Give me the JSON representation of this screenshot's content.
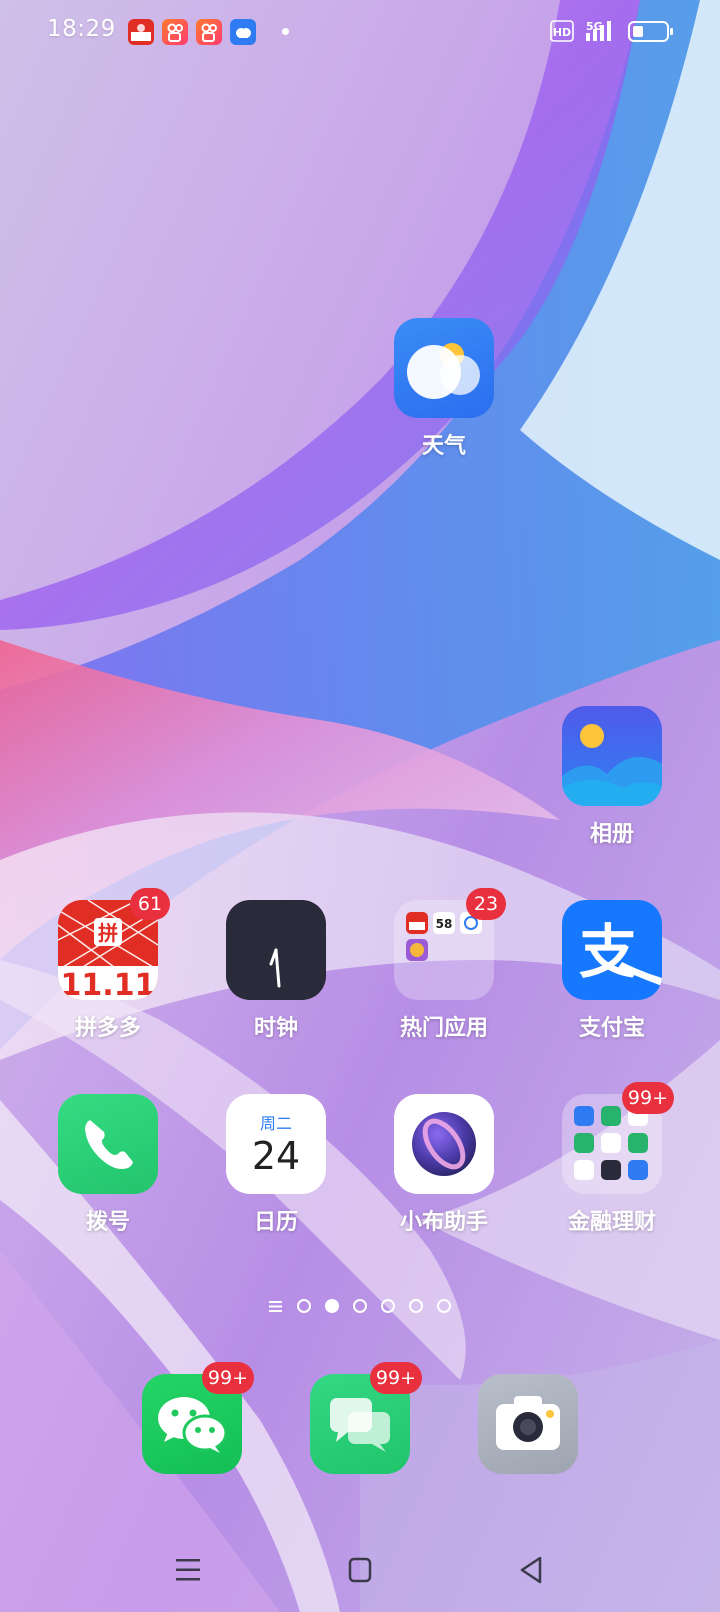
{
  "status_bar": {
    "time": "18:29",
    "notification_icons": [
      "pinduoduo-icon",
      "kuaishou-icon",
      "kuaishou-icon",
      "weather-icon"
    ],
    "hd_label": "HD",
    "network_label": "5G",
    "battery_level": 0.3
  },
  "apps": {
    "weather": {
      "label": "天气",
      "icon": "weather-icon"
    },
    "gallery": {
      "label": "相册",
      "icon": "gallery-icon"
    },
    "pinduoduo": {
      "label": "拼多多",
      "badge": "61",
      "icon_text": "11.11",
      "icon": "pinduoduo-icon"
    },
    "clock": {
      "label": "时钟",
      "icon": "clock-icon"
    },
    "hot_apps": {
      "label": "热门应用",
      "badge": "23",
      "icon": "folder-icon",
      "mini_text": "58"
    },
    "alipay": {
      "label": "支付宝",
      "icon_text": "支",
      "icon": "alipay-icon"
    },
    "phone": {
      "label": "拨号",
      "icon": "phone-icon"
    },
    "calendar": {
      "label": "日历",
      "weekday": "周二",
      "day": "24",
      "icon": "calendar-icon"
    },
    "breeno": {
      "label": "小布助手",
      "icon": "assistant-icon"
    },
    "finance": {
      "label": "金融理财",
      "badge": "99+",
      "icon": "folder-icon"
    }
  },
  "page_indicator": {
    "pages": 6,
    "active_page": 2
  },
  "dock": {
    "wechat": {
      "badge": "99+",
      "icon": "wechat-icon"
    },
    "messages": {
      "badge": "99+",
      "icon": "messages-icon"
    },
    "camera": {
      "icon": "camera-icon"
    }
  },
  "nav_bar": {
    "buttons": [
      "menu-icon",
      "home-icon",
      "back-icon"
    ]
  },
  "colors": {
    "badge": "#e8303e",
    "weather_bg": "#2f7bf2",
    "alipay_bg": "#1677ff",
    "phone_bg": "#2fd57a",
    "wechat_bg": "#1dc95c",
    "pinduoduo_red": "#e02e24"
  }
}
